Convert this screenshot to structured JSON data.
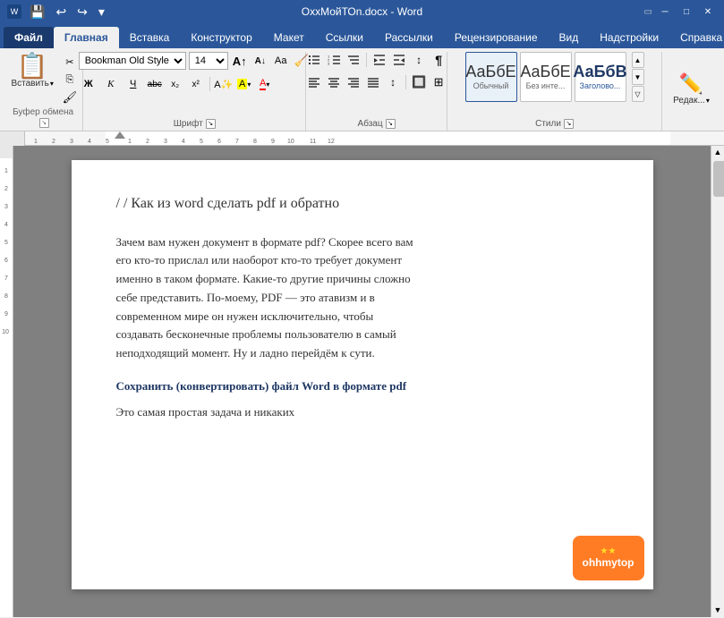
{
  "titleBar": {
    "appName": "Word",
    "fileName": "OxxМойТОn.docx",
    "fullTitle": "OxxМойТОn.docx - Word",
    "quickAccessIcons": [
      "save",
      "undo",
      "redo",
      "more"
    ]
  },
  "ribbonTabs": {
    "items": [
      {
        "id": "file",
        "label": "Файл"
      },
      {
        "id": "home",
        "label": "Главная",
        "active": true
      },
      {
        "id": "insert",
        "label": "Вставка"
      },
      {
        "id": "design",
        "label": "Конструктор"
      },
      {
        "id": "layout",
        "label": "Макет"
      },
      {
        "id": "references",
        "label": "Ссылки"
      },
      {
        "id": "mailings",
        "label": "Рассылки"
      },
      {
        "id": "review",
        "label": "Рецензирование"
      },
      {
        "id": "view",
        "label": "Вид"
      },
      {
        "id": "addins",
        "label": "Надстройки"
      },
      {
        "id": "help",
        "label": "Справка"
      }
    ]
  },
  "ribbon": {
    "clipboard": {
      "label": "Буфер обмена",
      "paste": "Вставить",
      "cut": "✂",
      "copy": "⎘",
      "formatPainter": "🖌"
    },
    "font": {
      "label": "Шрифт",
      "fontName": "Bookman Old Style",
      "fontSize": "14",
      "bold": "Ж",
      "italic": "К",
      "underline": "Ч",
      "strikethrough": "abc",
      "subscript": "x₂",
      "superscript": "x²",
      "changeCase": "Аа",
      "increaseFont": "A",
      "decreaseFont": "A",
      "fontColor": "А",
      "highlight": "А"
    },
    "paragraph": {
      "label": "Абзац",
      "bulletList": "≡",
      "numberedList": "≡",
      "multilevelList": "≡",
      "decreaseIndent": "←",
      "increaseIndent": "→",
      "sort": "↕",
      "showMarks": "¶",
      "alignLeft": "⬛",
      "alignCenter": "⬛",
      "alignRight": "⬛",
      "justify": "⬛",
      "lineSpacing": "↕",
      "shading": "🔲",
      "borders": "⊞"
    },
    "styles": {
      "label": "Стили",
      "items": [
        {
          "name": "Обычный",
          "preview": "Аа",
          "active": true
        },
        {
          "name": "Без инте...",
          "preview": "АаБбЕ"
        },
        {
          "name": "Заголово...",
          "preview": "АаБбВ"
        }
      ]
    },
    "editing": {
      "label": "Редактирование",
      "button": "Редак..."
    }
  },
  "document": {
    "title": "/ /  Как из word сделать pdf и обратно",
    "body1": "Зачем вам нужен документ в формате pdf? Скорее всего вам его кто-то прислал или наоборот кто-то требует документ именно в таком формате. Какие-то другие причины сложно себе представить. По-моему, PDF — это атавизм и в современном мире он нужен исключительно, чтобы создавать бесконечные проблемы пользователю в самый неподходящий момент. Ну и ладно перейдём к сути.",
    "sectionTitle": "Сохранить (конвертировать) файл Word в формате pdf",
    "body2": "Это самая простая задача и никаких"
  },
  "watermark": {
    "stars": "★★",
    "text": "ohhmytop"
  }
}
